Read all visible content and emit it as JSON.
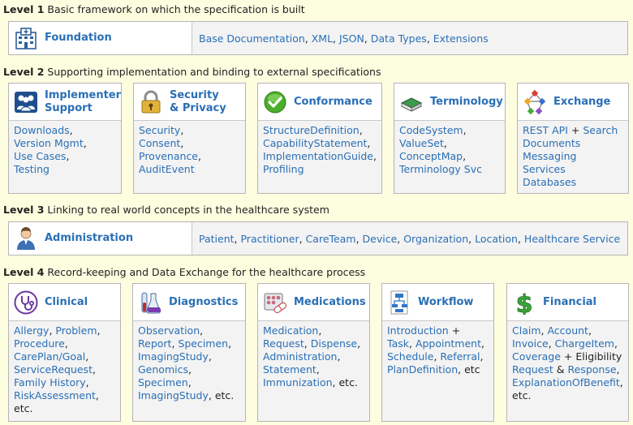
{
  "level1": {
    "num": "Level 1",
    "desc": "Basic framework on which the specification is built",
    "foundation": {
      "label": "Foundation",
      "links": [
        "Base Documentation",
        "XML",
        "JSON",
        "Data Types",
        "Extensions"
      ]
    }
  },
  "level2": {
    "num": "Level 2",
    "desc": "Supporting implementation and binding to external specifications",
    "implementer": {
      "label1": "Implementer",
      "label2": "Support",
      "l0": "Downloads",
      "l1": "Version Mgmt",
      "l2": "Use Cases",
      "l3": "Testing"
    },
    "security": {
      "label1": "Security",
      "label2": "& Privacy",
      "l0": "Security",
      "l1": "Consent",
      "l2": "Provenance",
      "l3": "AuditEvent"
    },
    "conformance": {
      "label": "Conformance",
      "l0": "StructureDefinition",
      "l1": "CapabilityStatement",
      "l2": "ImplementationGuide",
      "l3": "Profiling"
    },
    "terminology": {
      "label": "Terminology",
      "l0": "CodeSystem",
      "l1": "ValueSet",
      "l2": "ConceptMap",
      "l3": "Terminology Svc"
    },
    "exchange": {
      "label": "Exchange",
      "l0": "REST API",
      "plus": "+",
      "l1": "Search",
      "l2": "Documents",
      "l3": "Messaging",
      "l4": "Services",
      "l5": "Databases"
    }
  },
  "level3": {
    "num": "Level 3",
    "desc": "Linking to real world concepts in the healthcare system",
    "administration": {
      "label": "Administration",
      "links": [
        "Patient",
        "Practitioner",
        "CareTeam",
        "Device",
        "Organization",
        "Location",
        "Healthcare Service"
      ]
    }
  },
  "level4": {
    "num": "Level 4",
    "desc": "Record-keeping and Data Exchange for the healthcare process",
    "clinical": {
      "label": "Clinical",
      "l0": "Allergy",
      "l1": "Problem",
      "l2": "Procedure",
      "l3": "CarePlan/Goal",
      "l4": "ServiceRequest",
      "l5": "Family History",
      "l6": "RiskAssessment",
      "etc": "etc."
    },
    "diagnostics": {
      "label": "Diagnostics",
      "l0": "Observation",
      "l1": "Report",
      "l2": "Specimen",
      "l3": "ImagingStudy",
      "l4": "Genomics",
      "l5": "Specimen",
      "l6": "ImagingStudy",
      "etc": "etc."
    },
    "medications": {
      "label": "Medications",
      "l0": "Medication",
      "l1": "Request",
      "l2": "Dispense",
      "l3": "Administration",
      "l4": "Statement",
      "l5": "Immunization",
      "etc": "etc."
    },
    "workflow": {
      "label": "Workflow",
      "l0": "Introduction",
      "plus": "+",
      "l1": "Task",
      "l2": "Appointment",
      "l3": "Schedule",
      "l4": "Referral",
      "l5": "PlanDefinition",
      "etc": "etc"
    },
    "financial": {
      "label": "Financial",
      "l0": "Claim",
      "l1": "Account",
      "l2": "Invoice",
      "l3": "ChargeItem",
      "l4": "Coverage",
      "plus": "+",
      "l5": "Eligibility",
      "l6": "Request",
      "amp": "&",
      "l7": "Response",
      "l8": "ExplanationOfBenefit",
      "etc": "etc."
    }
  },
  "colors": {
    "link": "#2a6fb5",
    "background": "#fdfde0",
    "box_body": "#f3f3f3"
  },
  "icons": [
    "hospital-building-icon",
    "implementer-people-icon",
    "security-padlock-icon",
    "conformance-checkmark-icon",
    "terminology-book-icon",
    "exchange-network-icon",
    "administration-person-icon",
    "clinical-stethoscope-icon",
    "diagnostics-lab-flask-icon",
    "medications-pills-icon",
    "workflow-flowchart-icon",
    "financial-dollar-icon"
  ]
}
